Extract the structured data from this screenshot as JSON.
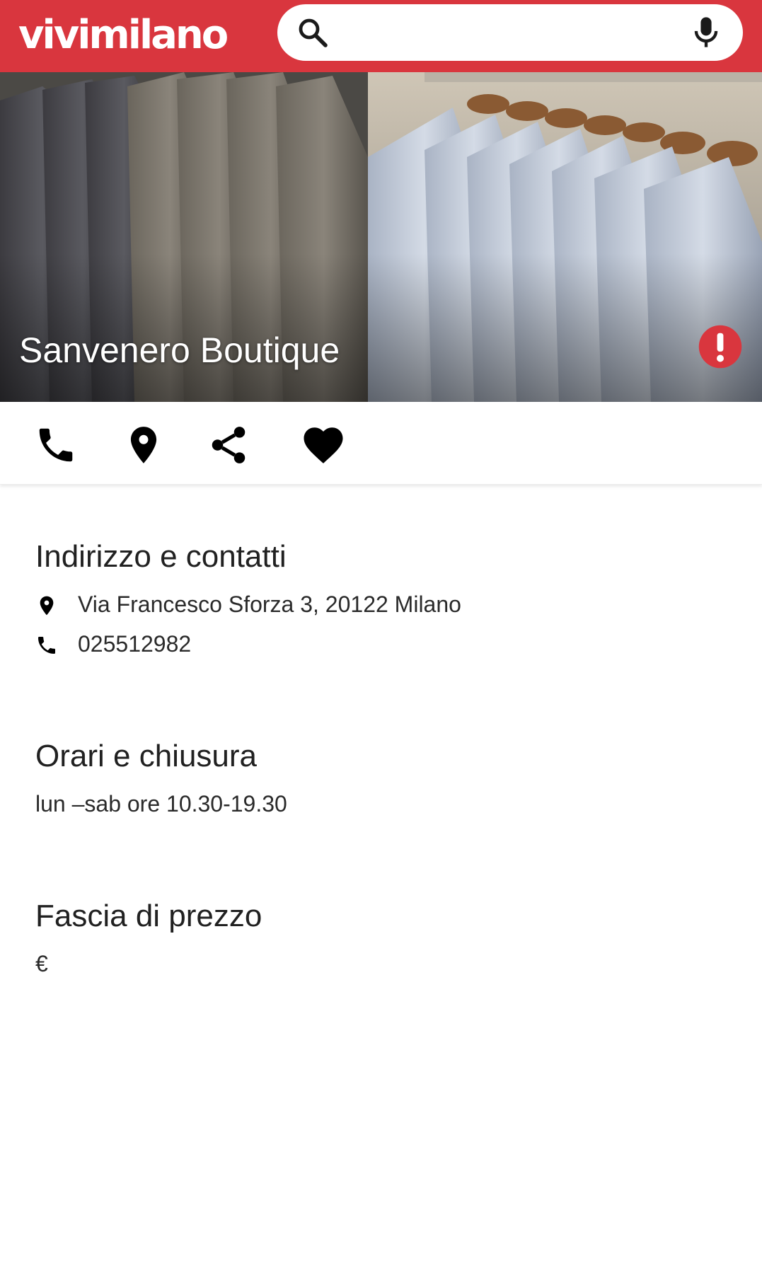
{
  "header": {
    "logo_text": "vivimilano",
    "search": {
      "placeholder": "",
      "value": "",
      "icon": "search-icon",
      "voice_icon": "microphone-icon"
    },
    "background_color": "#d9363e"
  },
  "hero": {
    "title": "Sanvenero Boutique",
    "image_description_icon": "clothing-rack-photo",
    "report_icon": "exclamation-icon",
    "report_color": "#d9363e"
  },
  "actions": [
    {
      "name": "call",
      "icon": "phone-icon"
    },
    {
      "name": "directions",
      "icon": "map-pin-icon"
    },
    {
      "name": "share",
      "icon": "share-icon"
    },
    {
      "name": "favorite",
      "icon": "heart-icon"
    }
  ],
  "contacts": {
    "title": "Indirizzo e contatti",
    "address": "Via Francesco Sforza 3, 20122 Milano",
    "phone": "025512982"
  },
  "hours": {
    "title": "Orari e chiusura",
    "text": "lun –sab ore 10.30-19.30"
  },
  "price": {
    "title": "Fascia di prezzo",
    "text": "€"
  }
}
